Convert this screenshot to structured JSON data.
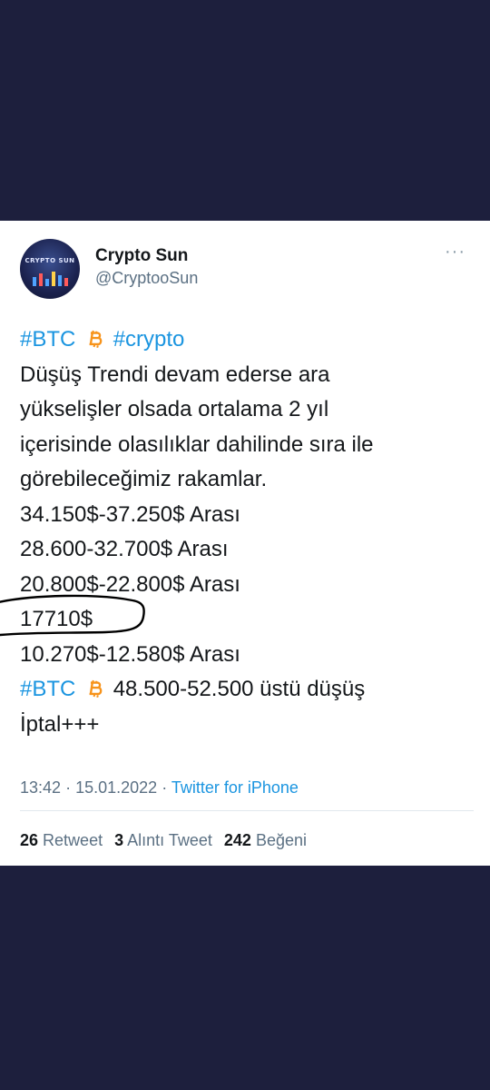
{
  "author": {
    "display_name": "Crypto Sun",
    "handle": "@CryptooSun",
    "avatar_text": "CRYPTO SUN"
  },
  "tweet": {
    "hashtag_btc": "#BTC",
    "hashtag_crypto": "#crypto",
    "lines": [
      "Düşüş Trendi devam ederse ara",
      "yükselişler olsada ortalama 2 yıl",
      "içerisinde olasılıklar dahilinde sıra ile",
      "görebileceğimiz rakamlar.",
      "34.150$-37.250$ Arası",
      "28.600-32.700$ Arası",
      "20.800$-22.800$ Arası",
      "17710$",
      "10.270$-12.580$ Arası"
    ],
    "last_hashtag": "#BTC",
    "last_text": "48.500-52.500 üstü düşüş",
    "final_line": "İptal+++"
  },
  "meta": {
    "time": "13:42",
    "date": "15.01.2022",
    "separator": "·",
    "source": "Twitter for iPhone"
  },
  "stats": {
    "retweets_count": "26",
    "retweets_label": "Retweet",
    "quotes_count": "3",
    "quotes_label": "Alıntı Tweet",
    "likes_count": "242",
    "likes_label": "Beğeni"
  },
  "colors": {
    "background": "#1d1f3d",
    "link": "#1b95e0",
    "bitcoin": "#f7931a",
    "text": "#14171a",
    "muted": "#5b7083"
  },
  "icons": {
    "more": "more-horizontal-icon",
    "btc": "bitcoin-icon"
  }
}
